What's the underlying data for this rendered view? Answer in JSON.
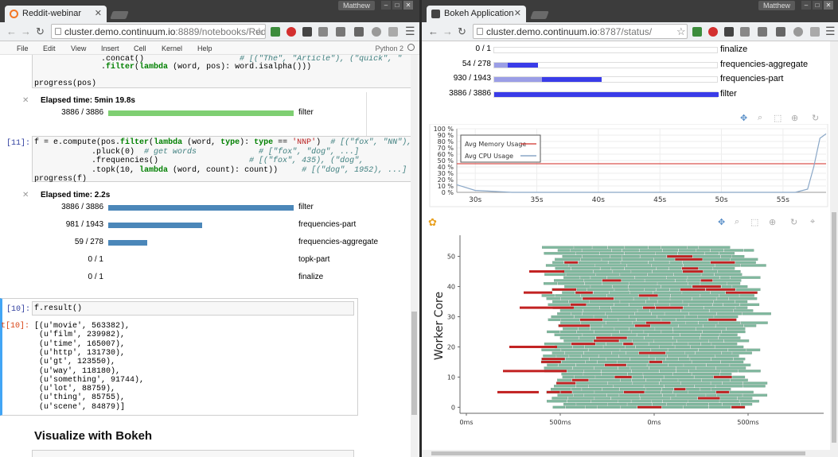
{
  "left": {
    "tab_title": "Reddit-webinar",
    "url_host": "cluster.demo.continuum.io",
    "url_rest": ":8889/notebooks/Redd",
    "user": "Matthew",
    "menu": [
      "File",
      "Edit",
      "View",
      "Insert",
      "Cell",
      "Kernel",
      "Help"
    ],
    "kernel": "Python 2",
    "cell0": {
      "line1_code": "              .concat()",
      "line1_comment": "                    # [(\"The\", \"Article\"), (\"quick\", \"",
      "line2_pre": "              .",
      "line2_kw1": "filter",
      "line2_mid": "(",
      "line2_kw2": "lambda",
      "line2_rest": " (word, pos): word.isalpha()))",
      "line3": "progress(pos)",
      "elapsed": "Elapsed time: 5min 19.8s",
      "rows": [
        {
          "count": "3886 / 3886",
          "frac": 1.0,
          "name": "filter"
        }
      ]
    },
    "cell11": {
      "prompt": "[11]:",
      "l1a": "f = e.compute(pos.",
      "l1kw": "filter",
      "l1b": "(",
      "l1kw2": "lambda",
      "l1c": " (word, ",
      "l1kw3": "type",
      "l1d": "): ",
      "l1kw4": "type",
      "l1e": " == ",
      "l1str": "'NNP'",
      "l1f": ")  ",
      "l1cm": "# [(\"fox\", \"NN\"), (\"dog",
      "l2a": "            .pluck(0)  ",
      "l2cm": "# get words",
      "l2cm2": "             # [\"fox\", \"dog\", ...]",
      "l3a": "            .frequencies()",
      "l3cm": "                   # [(\"fox\", 435), (\"dog\",",
      "l4a": "            .topk(10, ",
      "l4kw": "lambda",
      "l4b": " (word, count): count))",
      "l4cm": "     # [(\"dog\", 1952), ...]",
      "l5": "progress(f)",
      "elapsed": "Elapsed time: 2.2s",
      "rows": [
        {
          "count": "3886 / 3886",
          "frac": 1.0,
          "name": "filter"
        },
        {
          "count": "981 / 1943",
          "frac": 0.505,
          "name": "frequencies-part"
        },
        {
          "count": "59 / 278",
          "frac": 0.212,
          "name": "frequencies-aggregate"
        },
        {
          "count": "0 / 1",
          "frac": 0,
          "name": "topk-part"
        },
        {
          "count": "0 / 1",
          "frac": 0,
          "name": "finalize"
        }
      ]
    },
    "cell10": {
      "in_prompt": "[10]:",
      "code": "f.result()",
      "out_prompt": "t[10]:",
      "output": [
        "[(u'movie', 563382),",
        " (u'film', 239982),",
        " (u'time', 165007),",
        " (u'http', 131730),",
        " (u'gt', 123550),",
        " (u'way', 118180),",
        " (u'something', 91744),",
        " (u'lot', 88759),",
        " (u'thing', 85755),",
        " (u'scene', 84879)]"
      ]
    },
    "heading": "Visualize with Bokeh"
  },
  "right": {
    "tab_title": "Bokeh Application",
    "url_host": "cluster.demo.continuum.io",
    "url_rest": ":8787/status/",
    "user": "Matthew",
    "progress": [
      {
        "count": "0 / 1",
        "frac_done": 0,
        "frac_mem": 0,
        "name": "finalize"
      },
      {
        "count": "54 / 278",
        "frac_done": 0.194,
        "frac_mem": 0.06,
        "name": "frequencies-aggregate"
      },
      {
        "count": "930 / 1943",
        "frac_done": 0.479,
        "frac_mem": 0.212,
        "name": "frequencies-part"
      },
      {
        "count": "3886 / 3886",
        "frac_done": 1.0,
        "frac_mem": 0,
        "name": "filter"
      }
    ]
  },
  "colors": {
    "done_green": "#7fcf72",
    "progress_blue": "#4b87b9",
    "bokeh_blue": "#3a3ce8",
    "bokeh_light": "#9b9ee6",
    "memory_red": "#d9534f",
    "cpu_blue": "#8aa7c7",
    "task_green": "#7fb89e",
    "task_red": "#c22222"
  },
  "chart_data": [
    {
      "type": "line",
      "title": "",
      "xlabel": "",
      "ylabel": "",
      "x_ticks": [
        "30s",
        "35s",
        "40s",
        "45s",
        "50s",
        "55s"
      ],
      "y_ticks": [
        "0 %",
        "10 %",
        "20 %",
        "30 %",
        "40 %",
        "50 %",
        "60 %",
        "70 %",
        "80 %",
        "90 %",
        "100 %"
      ],
      "xlim": [
        28.5,
        58.5
      ],
      "ylim": [
        0,
        100
      ],
      "legend": "top-left",
      "series": [
        {
          "name": "Avg Memory Usage",
          "x": [
            28.5,
            58.5
          ],
          "values": [
            45,
            45
          ]
        },
        {
          "name": "Avg CPU Usage",
          "x": [
            28.5,
            29,
            30,
            31,
            32,
            33,
            35,
            37,
            40,
            45,
            50,
            55,
            56,
            57,
            57.5,
            58,
            58.5
          ],
          "values": [
            12,
            9,
            3,
            2,
            1,
            0,
            0,
            0,
            0,
            0,
            0,
            0,
            0,
            5,
            40,
            85,
            92
          ]
        }
      ]
    },
    {
      "type": "scatter",
      "title": "",
      "xlabel": "",
      "ylabel": "Worker Core",
      "x_ticks": [
        "0ms",
        "500ms",
        "0ms",
        "500ms"
      ],
      "y_ticks": [
        "0",
        "10",
        "20",
        "30",
        "40",
        "50"
      ],
      "ylim": [
        -2,
        57
      ],
      "task_rows": 54
    }
  ]
}
